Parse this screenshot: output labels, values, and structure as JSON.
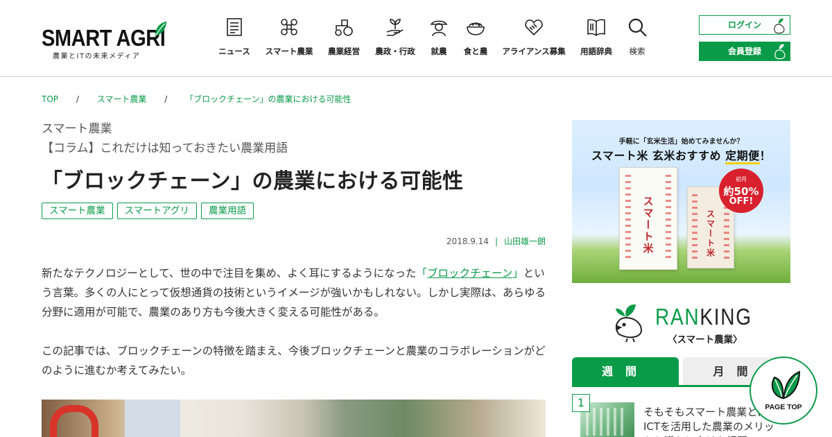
{
  "brand": {
    "logo_text": "SMART AGRI",
    "tagline": "農業とITの未来メディア",
    "green": "#0a9b48"
  },
  "nav": [
    {
      "label": "ニュース",
      "icon": "newspaper-icon"
    },
    {
      "label": "スマート農業",
      "icon": "drone-icon"
    },
    {
      "label": "農業経営",
      "icon": "tractor-icon"
    },
    {
      "label": "農政・行政",
      "icon": "sprout-hand-icon"
    },
    {
      "label": "就農",
      "icon": "farmer-icon"
    },
    {
      "label": "食と農",
      "icon": "rice-bowl-icon"
    },
    {
      "label": "アライアンス募集",
      "icon": "handshake-icon"
    },
    {
      "label": "用語辞典",
      "icon": "book-icon"
    },
    {
      "label": "検索",
      "icon": "search-icon"
    }
  ],
  "auth": {
    "login": "ログイン",
    "register": "会員登録"
  },
  "breadcrumb": {
    "items": [
      "TOP",
      "スマート農業",
      "「ブロックチェーン」の農業における可能性"
    ],
    "separator": "/"
  },
  "article": {
    "category": "スマート農業",
    "series": "【コラム】これだけは知っておきたい農業用語",
    "title": "「ブロックチェーン」の農業における可能性",
    "tags": [
      "スマート農業",
      "スマートアグリ",
      "農業用語"
    ],
    "date": "2018.9.14",
    "meta_separator": "|",
    "author": "山田雄一朗",
    "p1_before": "新たなテクノロジーとして、世の中で注目を集め、よく耳にするようになった",
    "p1_quote_open": "「",
    "p1_link": "ブロックチェーン",
    "p1_quote_close": "」",
    "p1_after": "という言葉。多くの人にとって仮想通貨の技術というイメージが強いかもしれない。しかし実際は、あらゆる分野に適用が可能で、農業のあり方も今後大きく変える可能性がある。",
    "p2": "この記事では、ブロックチェーンの特徴を踏まえ、今後ブロックチェーンと農業のコラボレーションがどのように進むか考えてみたい。"
  },
  "banner": {
    "top": "手軽に「玄米生活」始めてみませんか？",
    "main_prefix": "スマート米 玄米おすすめ ",
    "main_highlight": "定期便",
    "main_suffix": "！",
    "bag_text_1": "スマート米",
    "bag_text_2": "スマート米",
    "badge_1": "初月",
    "badge_2": "約50%",
    "badge_3": "OFF!"
  },
  "ranking": {
    "title_green": "RAN",
    "title_dark": "KING",
    "subtitle": "〈スマート農業〉",
    "tabs": [
      "週間",
      "月間"
    ],
    "items": [
      {
        "rank": "1",
        "text": "そもそもスマート農業とは？ ICTを活用した農業のメリットと導入に向けた課題"
      }
    ]
  },
  "pagetop": {
    "label": "PAGE TOP"
  }
}
